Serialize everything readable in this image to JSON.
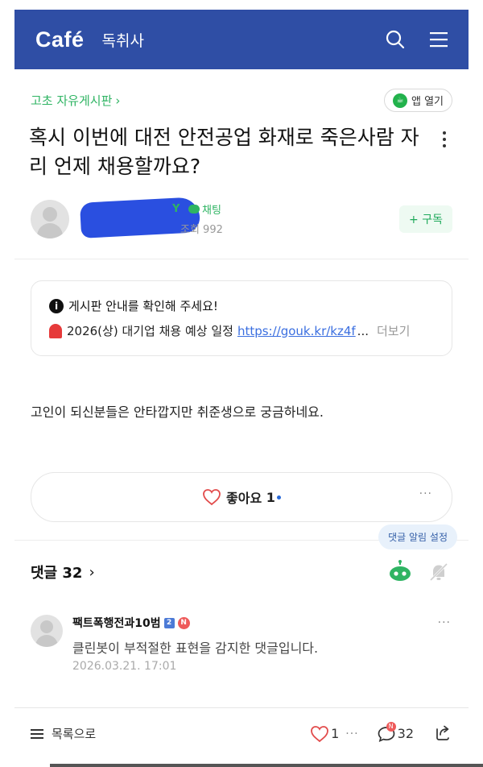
{
  "header": {
    "logo": "Café",
    "cafe_name": "독취사",
    "bg_color": "#2f4ea5",
    "icons": [
      "search-icon",
      "menu-icon"
    ]
  },
  "post": {
    "board": "고초 자유게시판",
    "board_chevron": "›",
    "app_open_label": "앱 열기",
    "title": "혹시 이번에 대전 안전공업 화재로 죽은사람 자리 언제 채용할까요?",
    "chat_label": "채팅",
    "views_label": "조회 992",
    "subscribe_label": "+ 구독",
    "body": "고인이 되신분들은 안타깝지만 취준생으로 궁금하네요."
  },
  "notice": {
    "line1": "게시판 안내를 확인해 주세요!",
    "line2_text": "2026(상) 대기업 채용 예상 일정",
    "line2_url": "https://gouk.kr/kz4f",
    "line2_ellipsis": "...",
    "more_label": "더보기"
  },
  "like": {
    "label": "좋아요",
    "count": "1",
    "more": "···"
  },
  "comments": {
    "tooltip": "댓글 알림 설정",
    "title": "댓글 32",
    "chevron": "›",
    "items": [
      {
        "author": "팩트폭행전과10범",
        "level_badge": "2",
        "new_badge": "N",
        "text": "클린봇이 부적절한 표현을 감지한 댓글입니다.",
        "date": "2026.03.21. 17:01",
        "more": "···"
      }
    ]
  },
  "bottom_bar": {
    "list_label": "목록으로",
    "like_count": "1",
    "dots": "···",
    "comment_count": "32",
    "comment_badge": "N"
  },
  "colors": {
    "accent_green": "#2fb463",
    "link_blue": "#3b6fe0"
  }
}
